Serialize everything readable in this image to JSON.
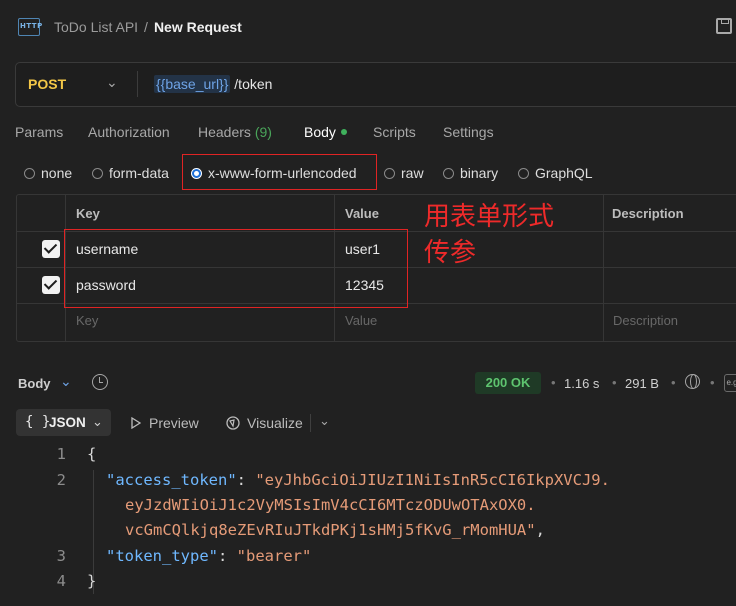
{
  "header": {
    "http_icon_text": "HTTP",
    "collection": "ToDo List API",
    "separator": "/",
    "title": "New Request"
  },
  "request": {
    "method": "POST",
    "url_variable": "{{base_url}}",
    "url_path": " /token"
  },
  "tabs": {
    "params": "Params",
    "authorization": "Authorization",
    "headers": "Headers",
    "headers_count": "(9)",
    "body": "Body",
    "scripts": "Scripts",
    "settings": "Settings"
  },
  "body_types": {
    "none": "none",
    "form_data": "form-data",
    "urlencoded": "x-www-form-urlencoded",
    "raw": "raw",
    "binary": "binary",
    "graphql": "GraphQL",
    "selected": "x-www-form-urlencoded"
  },
  "table": {
    "headers": {
      "key": "Key",
      "value": "Value",
      "description": "Description"
    },
    "rows": [
      {
        "checked": true,
        "key": "username",
        "value": "user1"
      },
      {
        "checked": true,
        "key": "password",
        "value": "12345"
      }
    ],
    "placeholder": {
      "key": "Key",
      "value": "Value",
      "description": "Description"
    }
  },
  "annotation": {
    "line1": "用表单形式",
    "line2": "传参",
    "color": "#e02424"
  },
  "response": {
    "label": "Body",
    "status": "200 OK",
    "bullet": "•",
    "time": "1.16 s",
    "size": "291 B",
    "example_icon_text": "e.g"
  },
  "format": {
    "braces": "{ }",
    "json": "JSON",
    "preview": "Preview",
    "visualize": "Visualize"
  },
  "code": {
    "line_numbers": [
      "1",
      "2",
      "3",
      "4"
    ],
    "open_brace": "{",
    "close_brace": "}",
    "key1": "\"access_token\"",
    "val1_part1": "\"eyJhbGciOiJIUzI1NiIsInR5cCI6IkpXVCJ9.",
    "val1_part2": "eyJzdWIiOiJ1c2VyMSIsImV4cCI6MTczODUwOTAxOX0.",
    "val1_part3": "vcGmCQlkjq8eZEvRIuJTkdPKj1sHMj5fKvG_rMomHUA\"",
    "key2": "\"token_type\"",
    "val2": "\"bearer\"",
    "colon": ": ",
    "comma": ","
  },
  "colors": {
    "background": "#212121",
    "method": "#f3c747",
    "variable": "#6ea3e6",
    "status_ok": "#5ec46f",
    "json_key": "#6fb8ff",
    "json_string": "#e59b78",
    "radio_selected": "#1d6fd6"
  }
}
